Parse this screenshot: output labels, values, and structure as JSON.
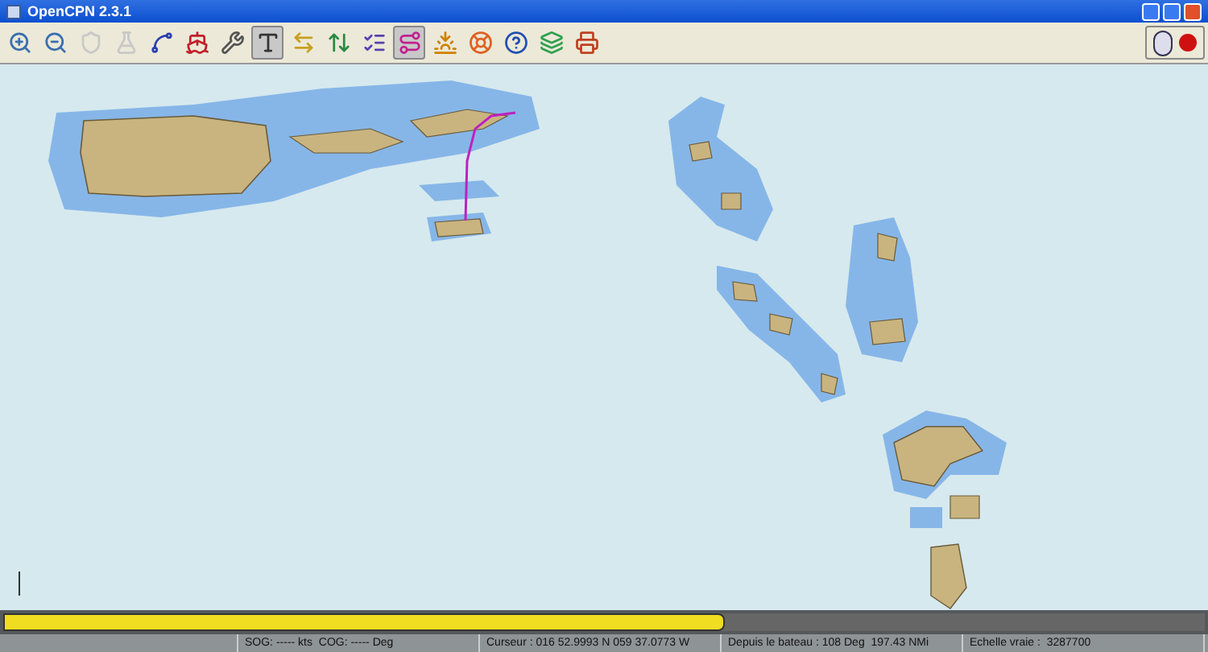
{
  "window": {
    "title": "OpenCPN 2.3.1"
  },
  "toolbar": [
    {
      "selected": false,
      "disabled": false
    },
    {
      "selected": false,
      "disabled": false
    },
    {
      "selected": false,
      "disabled": true
    },
    {
      "selected": false,
      "disabled": true
    },
    {
      "selected": false,
      "disabled": false
    },
    {
      "selected": false,
      "disabled": false
    },
    {
      "selected": false,
      "disabled": false
    },
    {
      "selected": true,
      "disabled": false
    },
    {
      "selected": false,
      "disabled": false
    },
    {
      "selected": false,
      "disabled": false
    },
    {
      "selected": false,
      "disabled": false
    },
    {
      "selected": true,
      "disabled": false
    },
    {
      "selected": false,
      "disabled": false
    },
    {
      "selected": false,
      "disabled": false
    },
    {
      "selected": false,
      "disabled": false
    },
    {
      "selected": false,
      "disabled": false
    },
    {
      "selected": false,
      "disabled": false
    }
  ],
  "chart_bar": {
    "level": 0.6
  },
  "status_bar": [
    "SOG: ----- kts  COG: ----- Deg",
    "Curseur : 016 52.9993 N 059 37.0773 W",
    "Depuis le bateau : 108 Deg  197.43 NMi",
    "Echelle vraie :  3287700"
  ]
}
